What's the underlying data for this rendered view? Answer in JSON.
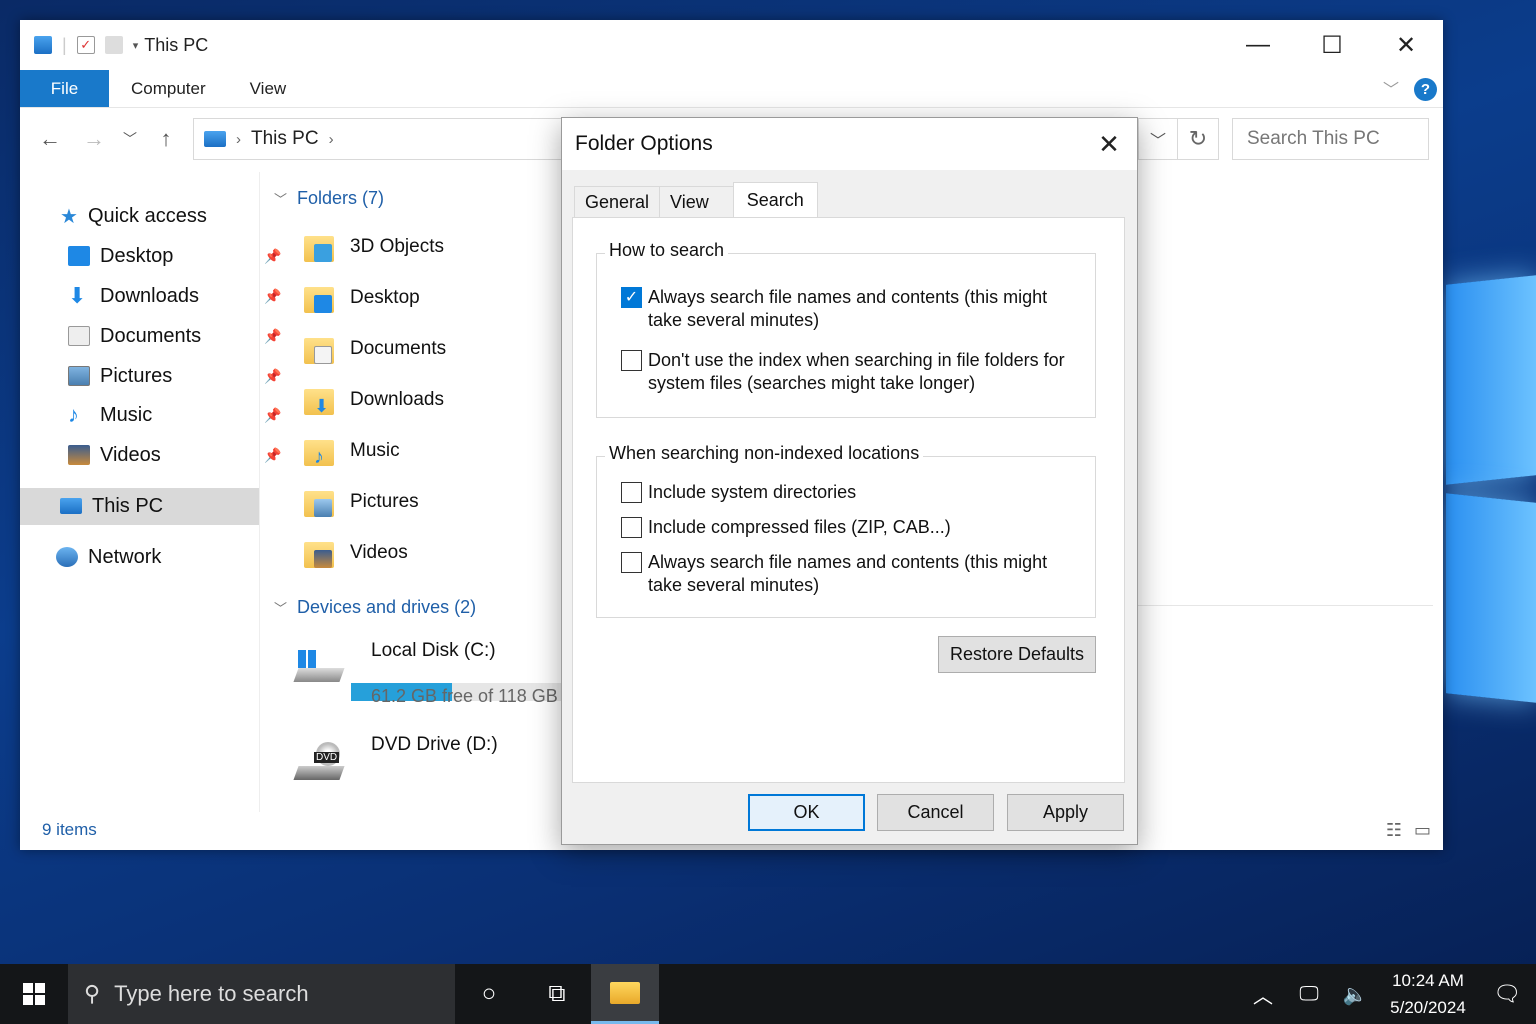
{
  "window": {
    "title": "This PC",
    "controls": [
      "—",
      "☐",
      "✕"
    ]
  },
  "ribbon": {
    "file_label": "File",
    "tabs": [
      "Computer",
      "View"
    ],
    "help_label": "?"
  },
  "address": {
    "crumb": "This PC",
    "search_placeholder": "Search This PC"
  },
  "nav": {
    "quick_access": "Quick access",
    "items": [
      {
        "label": "Desktop",
        "icon": "desktop-icon"
      },
      {
        "label": "Downloads",
        "icon": "downloads-icon"
      },
      {
        "label": "Documents",
        "icon": "documents-icon"
      },
      {
        "label": "Pictures",
        "icon": "pictures-icon"
      },
      {
        "label": "Music",
        "icon": "music-icon"
      },
      {
        "label": "Videos",
        "icon": "videos-icon"
      }
    ],
    "this_pc": "This PC",
    "network": "Network"
  },
  "content": {
    "folders_header": "Folders (7)",
    "folders": [
      "3D Objects",
      "Desktop",
      "Documents",
      "Downloads",
      "Music",
      "Pictures",
      "Videos"
    ],
    "drives_header": "Devices and drives (2)",
    "local_disk": {
      "name": "Local Disk (C:)",
      "free_text": "61.2 GB free of 118 GB",
      "used_fraction": 0.48
    },
    "dvd": {
      "name": "DVD Drive (D:)",
      "badge": "DVD"
    }
  },
  "status": {
    "items": "9 items"
  },
  "dialog": {
    "title": "Folder Options",
    "tabs": [
      "General",
      "View",
      "Search"
    ],
    "active_tab": "Search",
    "how_to_search": {
      "title": "How to search",
      "opt1": "Always search file names and contents (this might take several minutes)",
      "opt1_checked": true,
      "opt2": "Don't use the index when searching in file folders for system files (searches might take longer)",
      "opt2_checked": false
    },
    "non_indexed": {
      "title": "When searching non-indexed locations",
      "opt1": "Include system directories",
      "opt2": "Include compressed files (ZIP, CAB...)",
      "opt3": "Always search file names and contents (this might take several minutes)"
    },
    "restore_defaults": "Restore Defaults",
    "ok": "OK",
    "cancel": "Cancel",
    "apply": "Apply"
  },
  "taskbar": {
    "search_placeholder": "Type here to search",
    "time": "10:24 AM",
    "date": "5/20/2024"
  },
  "colors": {
    "accent": "#0078d7",
    "file_tab": "#1979ca",
    "link": "#1f5fa8"
  }
}
